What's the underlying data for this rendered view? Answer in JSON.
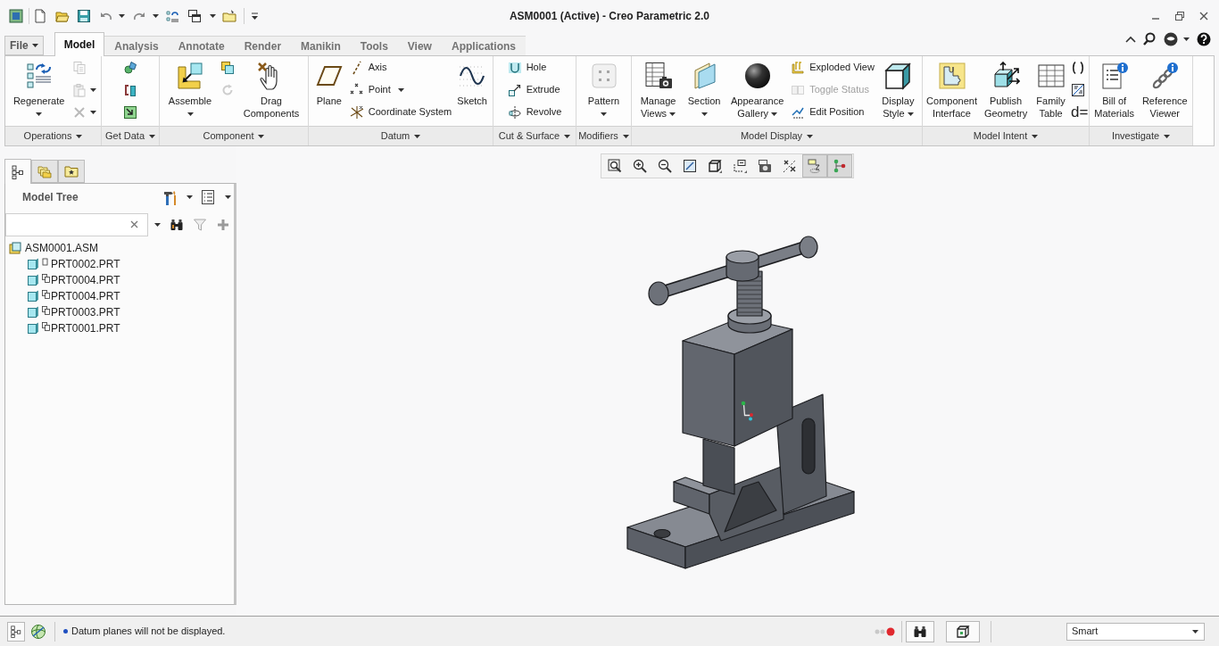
{
  "window": {
    "title": "ASM0001 (Active) - Creo Parametric 2.0"
  },
  "ribbon_tabs": [
    {
      "label": "File",
      "kind": "menu",
      "selected": false
    },
    {
      "label": "Model",
      "kind": "tab",
      "selected": true
    },
    {
      "label": "Analysis",
      "kind": "tab",
      "selected": false
    },
    {
      "label": "Annotate",
      "kind": "tab",
      "selected": false
    },
    {
      "label": "Render",
      "kind": "tab",
      "selected": false
    },
    {
      "label": "Manikin",
      "kind": "tab",
      "selected": false
    },
    {
      "label": "Tools",
      "kind": "tab",
      "selected": false
    },
    {
      "label": "View",
      "kind": "tab",
      "selected": false
    },
    {
      "label": "Applications",
      "kind": "tab",
      "selected": false
    }
  ],
  "ribbon_groups": [
    {
      "label": "Operations",
      "commands": [
        {
          "kind": "large",
          "label": "Regenerate",
          "menu": true,
          "disabled": false
        },
        {
          "kind": "icon",
          "menu": false,
          "disabled": true
        },
        {
          "kind": "icon",
          "menu": true,
          "disabled": true
        },
        {
          "kind": "icon",
          "menu": true,
          "disabled": true
        }
      ]
    },
    {
      "label": "Get Data",
      "commands": [
        {
          "kind": "icon",
          "menu": false,
          "disabled": false
        },
        {
          "kind": "icon",
          "menu": false,
          "disabled": false
        },
        {
          "kind": "icon",
          "menu": false,
          "disabled": false
        }
      ]
    },
    {
      "label": "Component",
      "commands": [
        {
          "kind": "large",
          "label": "Assemble",
          "menu": true,
          "disabled": false
        },
        {
          "kind": "icon",
          "menu": false,
          "disabled": false
        },
        {
          "kind": "icon",
          "menu": false,
          "disabled": true
        },
        {
          "kind": "large",
          "label": "Drag Components",
          "menu": false,
          "disabled": false
        }
      ]
    },
    {
      "label": "Datum",
      "commands": [
        {
          "kind": "large",
          "label": "Plane",
          "menu": false,
          "disabled": false
        },
        {
          "kind": "small",
          "label": "Axis",
          "menu": false,
          "disabled": false
        },
        {
          "kind": "small",
          "label": "Point",
          "menu": true,
          "disabled": false
        },
        {
          "kind": "small",
          "label": "Coordinate System",
          "menu": false,
          "disabled": false
        },
        {
          "kind": "large",
          "label": "Sketch",
          "menu": false,
          "disabled": false
        }
      ]
    },
    {
      "label": "Cut & Surface",
      "commands": [
        {
          "kind": "small",
          "label": "Hole",
          "menu": false,
          "disabled": false
        },
        {
          "kind": "small",
          "label": "Extrude",
          "menu": false,
          "disabled": false
        },
        {
          "kind": "small",
          "label": "Revolve",
          "menu": false,
          "disabled": false
        }
      ]
    },
    {
      "label": "Modifiers",
      "commands": [
        {
          "kind": "large",
          "label": "Pattern",
          "menu": true,
          "disabled": false
        }
      ]
    },
    {
      "label": "Model Display",
      "commands": [
        {
          "kind": "large",
          "label": "Manage Views",
          "menu": true,
          "disabled": false
        },
        {
          "kind": "large",
          "label": "Section",
          "menu": true,
          "disabled": false
        },
        {
          "kind": "large",
          "label": "Appearance Gallery",
          "menu": true,
          "disabled": false
        },
        {
          "kind": "small",
          "label": "Exploded View",
          "menu": false,
          "disabled": false
        },
        {
          "kind": "small",
          "label": "Toggle Status",
          "menu": false,
          "disabled": true
        },
        {
          "kind": "small",
          "label": "Edit Position",
          "menu": false,
          "disabled": false
        },
        {
          "kind": "large",
          "label": "Display Style",
          "menu": true,
          "disabled": false
        }
      ]
    },
    {
      "label": "Model Intent",
      "commands": [
        {
          "kind": "large",
          "label": "Component Interface",
          "menu": false,
          "disabled": false
        },
        {
          "kind": "large",
          "label": "Publish Geometry",
          "menu": false,
          "disabled": false
        },
        {
          "kind": "large",
          "label": "Family Table",
          "menu": false,
          "disabled": false
        },
        {
          "kind": "icon",
          "menu": false,
          "disabled": false
        },
        {
          "kind": "icon",
          "menu": false,
          "disabled": false
        },
        {
          "kind": "glyph",
          "label": "d=",
          "menu": false,
          "disabled": false
        }
      ]
    },
    {
      "label": "Investigate",
      "commands": [
        {
          "kind": "large",
          "label": "Bill of Materials",
          "menu": false,
          "disabled": false
        },
        {
          "kind": "large",
          "label": "Reference Viewer",
          "menu": false,
          "disabled": false
        }
      ]
    }
  ],
  "navigator_tabs": [
    {
      "selected": true
    },
    {
      "selected": false
    },
    {
      "selected": false
    }
  ],
  "model_tree": {
    "title": "Model Tree",
    "items": [
      {
        "label": "ASM0001.ASM",
        "kind": "assembly",
        "selected": false,
        "children": [
          {
            "label": "PRT0002.PRT",
            "kind": "plain",
            "selected": false
          },
          {
            "label": "PRT0004.PRT",
            "kind": "linked",
            "selected": false
          },
          {
            "label": "PRT0004.PRT",
            "kind": "linked",
            "selected": false
          },
          {
            "label": "PRT0003.PRT",
            "kind": "linked",
            "selected": false
          },
          {
            "label": "PRT0001.PRT",
            "kind": "linked",
            "selected": false
          }
        ]
      }
    ]
  },
  "view_toolbar": [
    {
      "on": false
    },
    {
      "on": false
    },
    {
      "on": false
    },
    {
      "on": false
    },
    {
      "on": false
    },
    {
      "on": false
    },
    {
      "on": false
    },
    {
      "on": false
    },
    {
      "on": true
    },
    {
      "on": true
    }
  ],
  "status_bar": {
    "message": "Datum planes will not be displayed.",
    "selection_filter": "Smart"
  }
}
